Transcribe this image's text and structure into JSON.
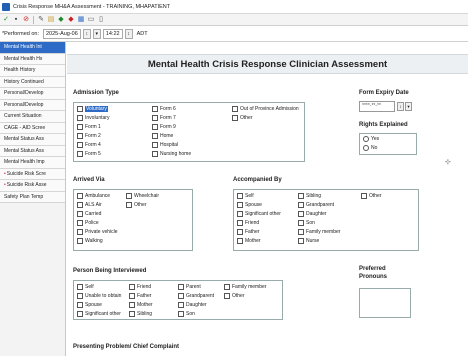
{
  "window": {
    "title": "Crisis Response MH&A Assessment - TRAINING, MHAPATIENT"
  },
  "toolbar": {
    "icons": [
      "check-icon",
      "save-icon",
      "cancel-icon",
      "tool-icon",
      "folder-icon",
      "arrow-up-icon",
      "arrow-down-icon",
      "calendar-icon",
      "print-icon",
      "document-icon"
    ]
  },
  "performed": {
    "label": "*Performed on:",
    "date": "2025-Aug-06",
    "time": "14:22",
    "tz": "ADT"
  },
  "sidebar": {
    "items": [
      {
        "label": "Mental Health Int",
        "active": true,
        "marked": false
      },
      {
        "label": "Mental Health Hx",
        "active": false,
        "marked": false
      },
      {
        "label": "Health History",
        "active": false,
        "marked": false
      },
      {
        "label": "History Continued",
        "active": false,
        "marked": false
      },
      {
        "label": "Personal/Develop",
        "active": false,
        "marked": false
      },
      {
        "label": "Personal/Develop",
        "active": false,
        "marked": false
      },
      {
        "label": "Current Situation",
        "active": false,
        "marked": false
      },
      {
        "label": "CAGE - AID Scree",
        "active": false,
        "marked": false
      },
      {
        "label": "Mental Status Ass",
        "active": false,
        "marked": false
      },
      {
        "label": "Mental Status Ass",
        "active": false,
        "marked": false
      },
      {
        "label": "Mental Health Imp",
        "active": false,
        "marked": false
      },
      {
        "label": "Suicide Risk Scre",
        "active": false,
        "marked": true
      },
      {
        "label": "Suicide Risk Asse",
        "active": false,
        "marked": true
      },
      {
        "label": "Safety Plan Temp",
        "active": false,
        "marked": false
      }
    ]
  },
  "form": {
    "title": "Mental Health Crisis Response Clinician Assessment",
    "admission": {
      "heading": "Admission Type",
      "col1": [
        "Voluntary",
        "Involuntary",
        "Form 1",
        "Form 2",
        "Form 4",
        "Form 5"
      ],
      "col2": [
        "Form 6",
        "Form 7",
        "Form 9",
        "Home",
        "Hospital",
        "Nursing home"
      ],
      "col3": [
        "Out of Province Admission",
        "Other"
      ],
      "selected": "Voluntary"
    },
    "form_expiry": {
      "heading": "Form Expiry Date",
      "placeholder": "****-**-**"
    },
    "rights": {
      "heading": "Rights Explained",
      "options": [
        "Yes",
        "No"
      ]
    },
    "arrived": {
      "heading": "Arrived Via",
      "col1": [
        "Ambulance",
        "ALS Air",
        "Carried",
        "Police",
        "Private vehicle",
        "Walking"
      ],
      "col2": [
        "Wheelchair",
        "Other"
      ]
    },
    "accompanied": {
      "heading": "Accompanied By",
      "col1": [
        "Self",
        "Spouse",
        "Significant other",
        "Friend",
        "Father",
        "Mother"
      ],
      "col2": [
        "Sibling",
        "Grandparent",
        "Daughter",
        "Son",
        "Family member",
        "Nurse"
      ],
      "col3": [
        "Other"
      ]
    },
    "interviewed": {
      "heading": "Person Being Interviewed",
      "col1": [
        "Self",
        "Unable to obtain",
        "Spouse",
        "Significant other"
      ],
      "col2": [
        "Friend",
        "Father",
        "Mother",
        "Sibling"
      ],
      "col3": [
        "Parent",
        "Grandparent",
        "Daughter",
        "Son"
      ],
      "col4": [
        "Family member",
        "Other"
      ]
    },
    "pronouns": {
      "heading_line1": "Preferred",
      "heading_line2": "Pronouns"
    },
    "presenting": {
      "heading": "Presenting Problem/ Chief Complaint"
    }
  },
  "colors": {
    "accent": "#2e6bc6",
    "banner_bg": "#edf0f3",
    "sidebar_bg": "#f3f3f3"
  }
}
